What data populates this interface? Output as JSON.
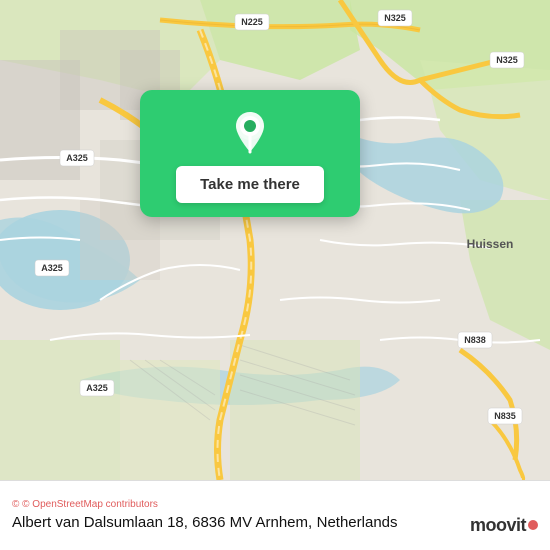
{
  "map": {
    "attribution": "© OpenStreetMap contributors",
    "location_card": {
      "button_label": "Take me there"
    }
  },
  "bottom_bar": {
    "attribution": "© OpenStreetMap contributors",
    "address": "Albert van Dalsumlaan 18, 6836 MV Arnhem,",
    "country": "Netherlands",
    "logo": "moovit"
  },
  "road_labels": {
    "n225": "N225",
    "n325_top": "N325",
    "n325_right": "N325",
    "a325_center": "A325",
    "a325_left": "A325",
    "a325_bottom_left": "A325",
    "a325_bottom": "A325",
    "n838": "N838",
    "n835": "N835",
    "huissen": "Huissen"
  },
  "colors": {
    "map_background": "#e8e4dc",
    "green_area": "#c8e6a0",
    "water": "#aad3df",
    "road_major": "#f5c842",
    "road_minor": "#ffffff",
    "card_green": "#2ecc71",
    "text_dark": "#333333",
    "attribution_color": "#e05c5c"
  }
}
